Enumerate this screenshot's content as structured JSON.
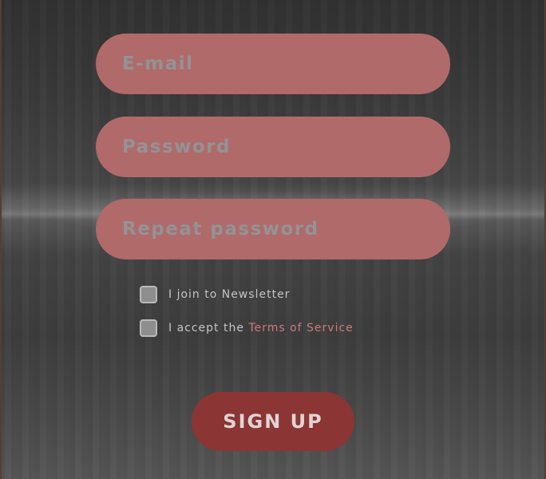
{
  "form": {
    "email_placeholder": "E-mail",
    "password_placeholder": "Password",
    "repeat_password_placeholder": "Repeat password",
    "newsletter_label": "I join to Newsletter",
    "newsletter_checked": false,
    "terms_prefix": "I accept the ",
    "terms_link": "Terms of Service",
    "terms_checked": false,
    "submit_label": "SIGN UP"
  },
  "colors": {
    "field_bg": "#b06a6a",
    "button_bg": "#8b3535",
    "link": "#c97a7a",
    "placeholder": "#8f9b9e"
  }
}
